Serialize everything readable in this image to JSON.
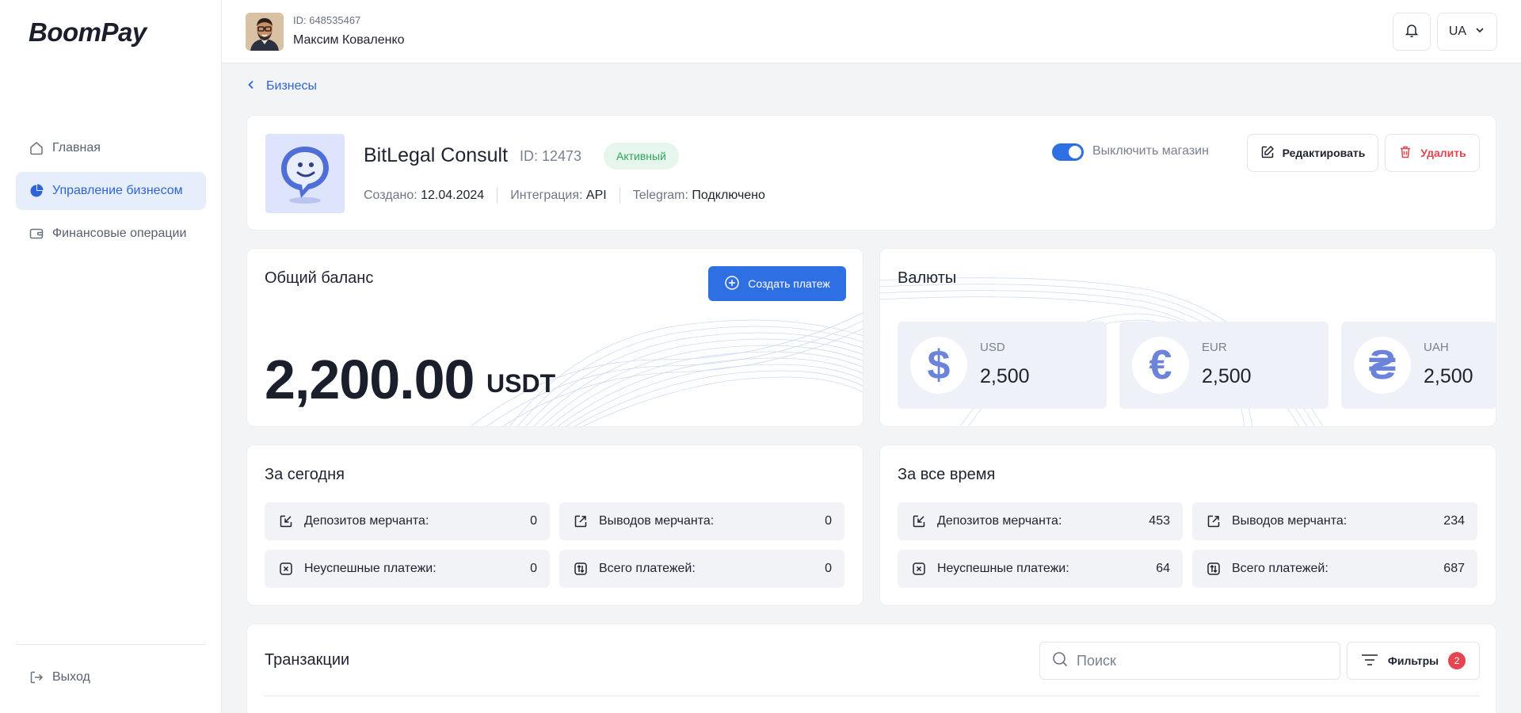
{
  "brand": {
    "logo": "BoomPay"
  },
  "sidebar": {
    "items": [
      {
        "label": "Главная",
        "icon": "home-icon",
        "active": false
      },
      {
        "label": "Управление бизнесом",
        "icon": "pie-chart-icon",
        "active": true
      },
      {
        "label": "Финансовые операции",
        "icon": "wallet-icon",
        "active": false
      }
    ],
    "logout_label": "Выход"
  },
  "header": {
    "user_id": "ID: 648535467",
    "user_name": "Максим Коваленко",
    "language": "UA"
  },
  "breadcrumb": {
    "back_label": "Бизнесы"
  },
  "business": {
    "name": "BitLegal Consult",
    "id": "ID: 12473",
    "status": "Активный",
    "created_label": "Создано:",
    "created_value": "12.04.2024",
    "integration_label": "Интеграция:",
    "integration_value": "API",
    "telegram_label": "Telegram:",
    "telegram_value": "Подключено",
    "toggle_label": "Выключить магазин",
    "toggle_on": true,
    "edit_label": "Редактировать",
    "delete_label": "Удалить"
  },
  "balance": {
    "title": "Общий баланс",
    "create_label": "Создать платеж",
    "amount": "2,200.00",
    "currency": "USDT"
  },
  "currencies": {
    "title": "Валюты",
    "items": [
      {
        "symbol": "$",
        "code": "USD",
        "value": "2,500"
      },
      {
        "symbol": "€",
        "code": "EUR",
        "value": "2,500"
      },
      {
        "symbol": "₴",
        "code": "UAH",
        "value": "2,500"
      }
    ]
  },
  "today": {
    "title": "За сегодня",
    "deposits_label": "Депозитов мерчанта:",
    "deposits": "0",
    "withdrawals_label": "Выводов мерчанта:",
    "withdrawals": "0",
    "failed_label": "Неуспешные платежи:",
    "failed": "0",
    "total_label": "Всего платежей:",
    "total": "0"
  },
  "all_time": {
    "title": "За все время",
    "deposits_label": "Депозитов мерчанта:",
    "deposits": "453",
    "withdrawals_label": "Выводов мерчанта:",
    "withdrawals": "234",
    "failed_label": "Неуспешные платежи:",
    "failed": "64",
    "total_label": "Всего платежей:",
    "total": "687"
  },
  "transactions": {
    "title": "Транзакции",
    "search_placeholder": "Поиск",
    "filters_label": "Фильтры",
    "filters_count": "2"
  },
  "colors": {
    "accent": "#2f6fe4",
    "active_bg": "#e6edfb",
    "danger": "#e0464f",
    "success": "#2ea55a"
  }
}
